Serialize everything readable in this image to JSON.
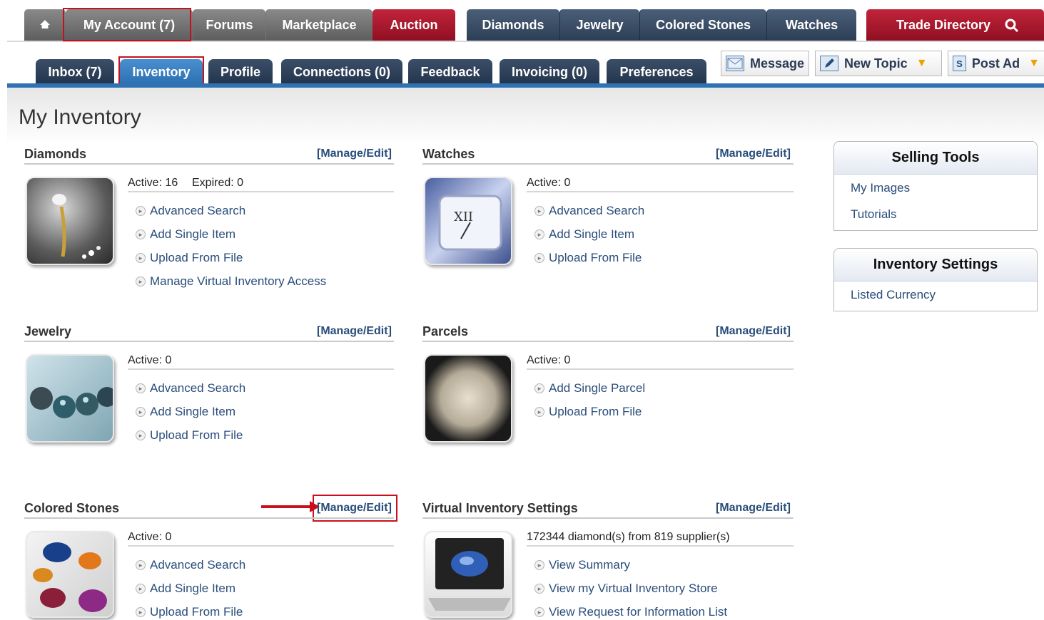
{
  "topnav": {
    "home_icon": "home-icon",
    "my_account": "My Account (7)",
    "forums": "Forums",
    "marketplace": "Marketplace",
    "auction": "Auction",
    "diamonds": "Diamonds",
    "jewelry": "Jewelry",
    "colored_stones": "Colored Stones",
    "watches": "Watches",
    "trade_directory": "Trade Directory"
  },
  "subnav": {
    "inbox": "Inbox (7)",
    "inventory": "Inventory",
    "profile": "Profile",
    "connections": "Connections (0)",
    "feedback": "Feedback",
    "invoicing": "Invoicing (0)",
    "preferences": "Preferences"
  },
  "actions": {
    "message": "Message",
    "new_topic": "New Topic",
    "post_ad": "Post Ad",
    "post_ad_icon_text": "S"
  },
  "page_title": "My Inventory",
  "manage_label": "[Manage/Edit]",
  "sections": {
    "diamonds": {
      "title": "Diamonds",
      "active": "Active: 16",
      "expired": "Expired: 0",
      "links": [
        "Advanced Search",
        "Add Single Item",
        "Upload From File",
        "Manage Virtual Inventory Access"
      ]
    },
    "watches": {
      "title": "Watches",
      "active": "Active: 0",
      "links": [
        "Advanced Search",
        "Add Single Item",
        "Upload From File"
      ]
    },
    "jewelry": {
      "title": "Jewelry",
      "active": "Active: 0",
      "links": [
        "Advanced Search",
        "Add Single Item",
        "Upload From File"
      ]
    },
    "parcels": {
      "title": "Parcels",
      "active": "Active: 0",
      "links": [
        "Add Single Parcel",
        "Upload From File"
      ]
    },
    "colored_stones": {
      "title": "Colored Stones",
      "active": "Active: 0",
      "links": [
        "Advanced Search",
        "Add Single Item",
        "Upload From File"
      ]
    },
    "virtual": {
      "title": "Virtual Inventory Settings",
      "summary": "172344 diamond(s) from 819 supplier(s)",
      "links": [
        "View Summary",
        "View my Virtual Inventory Store",
        "View Request for Information List"
      ]
    }
  },
  "sidebar": {
    "selling_tools": {
      "title": "Selling Tools",
      "links": [
        "My Images",
        "Tutorials"
      ]
    },
    "inventory_settings": {
      "title": "Inventory Settings",
      "links": [
        "Listed Currency"
      ]
    }
  },
  "colors": {
    "accent_red": "#c8101c",
    "nav_blue": "#2f72b3",
    "link_blue": "#2a4d7a"
  }
}
